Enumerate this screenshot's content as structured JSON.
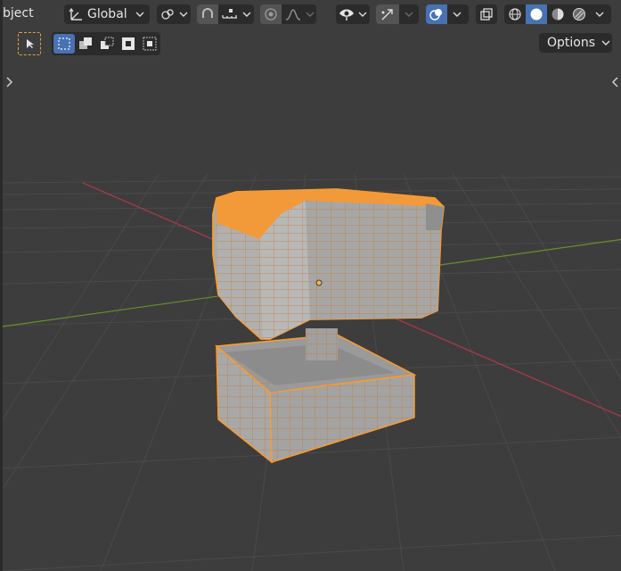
{
  "header": {
    "mode_label": "bject",
    "orientation_label": "Global",
    "options_label": "Options"
  },
  "colors": {
    "viewport_bg": "#3d3d3d",
    "toolbar_bg": "#2b2b2b",
    "accent_blue": "#4772b3",
    "selection_orange": "#ff9b2a",
    "mesh_gray": "#a8a8a8",
    "x_axis": "#b03a48",
    "y_axis": "#6a8f2e"
  },
  "icons": [
    "transform-orientation-icon",
    "pivot-point-icon",
    "snap-magnet-icon",
    "snap-increment-icon",
    "proportional-edit-icon",
    "falloff-curve-icon",
    "visibility-eye-icon",
    "gizmo-icon",
    "overlay-icon",
    "xray-icon",
    "wireframe-shading-icon",
    "solid-shading-icon",
    "material-shading-icon",
    "rendered-shading-icon",
    "select-tool-icon",
    "select-box-new-icon",
    "select-box-extend-icon",
    "select-box-subtract-icon",
    "select-box-invert-icon",
    "select-box-intersect-icon"
  ]
}
